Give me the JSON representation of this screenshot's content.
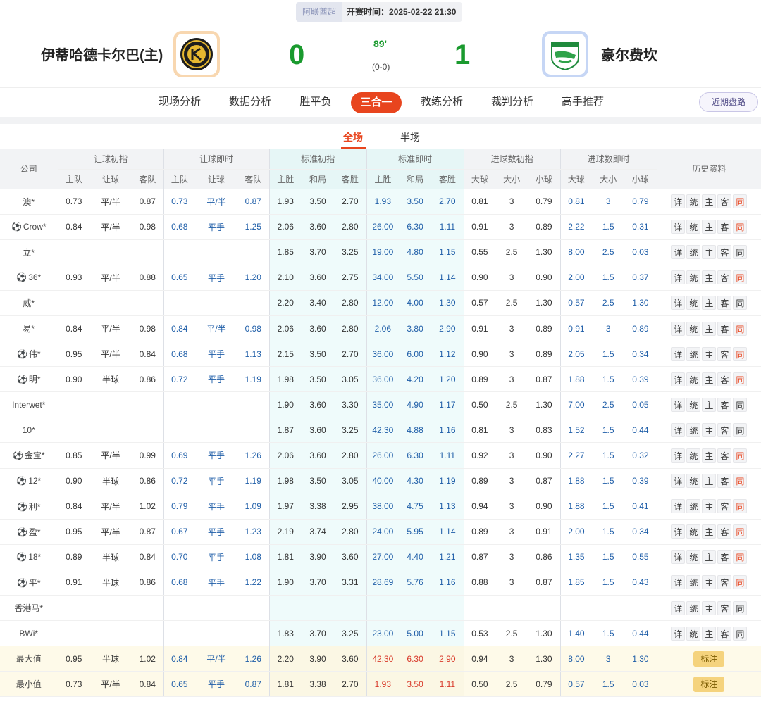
{
  "match": {
    "league": "阿联酋超",
    "kickoff": "开赛时间：2025-02-22 21:30",
    "home": {
      "name": "伊蒂哈德卡尔巴(主)",
      "logo_icon": "etihad-kalba-crest-icon",
      "score": "0"
    },
    "away": {
      "name": "豪尔费坎",
      "logo_icon": "khor-fakkan-crest-icon",
      "score": "1"
    },
    "minute": "89'",
    "halftime": "(0-0)"
  },
  "nav": {
    "tabs": [
      "现场分析",
      "数据分析",
      "胜平负",
      "三合一",
      "教练分析",
      "裁判分析",
      "高手推荐"
    ],
    "active": "三合一",
    "right_button": "近期盘路"
  },
  "subtabs": {
    "full": "全场",
    "half": "半场"
  },
  "table": {
    "groups": {
      "company": "公司",
      "ah_init": "让球初指",
      "ah_live": "让球即时",
      "eu_init": "标准初指",
      "eu_live": "标准即时",
      "ou_init": "进球数初指",
      "ou_live": "进球数即时",
      "history": "历史资料"
    },
    "sub": {
      "home": "主队",
      "handicap": "让球",
      "away": "客队",
      "win": "主胜",
      "draw": "和局",
      "lose": "客胜",
      "over": "大球",
      "line": "大小",
      "under": "小球"
    },
    "history_buttons": [
      "详",
      "统",
      "主",
      "客",
      "同"
    ],
    "rows": [
      {
        "company": "澳*",
        "ball": false,
        "ah_init": [
          "0.73",
          "平/半",
          "0.87"
        ],
        "ah_live": [
          "0.73",
          "平/半",
          "0.87"
        ],
        "eu_init": [
          "1.93",
          "3.50",
          "2.70"
        ],
        "eu_live": [
          "1.93",
          "3.50",
          "2.70"
        ],
        "ou_init": [
          "0.81",
          "3",
          "0.79"
        ],
        "ou_live": [
          "0.81",
          "3",
          "0.79"
        ],
        "same_red": true
      },
      {
        "company": "Crow*",
        "ball": true,
        "ah_init": [
          "0.84",
          "平/半",
          "0.98"
        ],
        "ah_live": [
          "0.68",
          "平手",
          "1.25"
        ],
        "eu_init": [
          "2.06",
          "3.60",
          "2.80"
        ],
        "eu_live": [
          "26.00",
          "6.30",
          "1.11"
        ],
        "ou_init": [
          "0.91",
          "3",
          "0.89"
        ],
        "ou_live": [
          "2.22",
          "1.5",
          "0.31"
        ],
        "same_red": true
      },
      {
        "company": "立*",
        "ball": false,
        "ah_init": [
          "",
          "",
          ""
        ],
        "ah_live": [
          "",
          "",
          ""
        ],
        "eu_init": [
          "1.85",
          "3.70",
          "3.25"
        ],
        "eu_live": [
          "19.00",
          "4.80",
          "1.15"
        ],
        "ou_init": [
          "0.55",
          "2.5",
          "1.30"
        ],
        "ou_live": [
          "8.00",
          "2.5",
          "0.03"
        ],
        "same_red": false
      },
      {
        "company": "36*",
        "ball": true,
        "ah_init": [
          "0.93",
          "平/半",
          "0.88"
        ],
        "ah_live": [
          "0.65",
          "平手",
          "1.20"
        ],
        "eu_init": [
          "2.10",
          "3.60",
          "2.75"
        ],
        "eu_live": [
          "34.00",
          "5.50",
          "1.14"
        ],
        "ou_init": [
          "0.90",
          "3",
          "0.90"
        ],
        "ou_live": [
          "2.00",
          "1.5",
          "0.37"
        ],
        "same_red": true
      },
      {
        "company": "威*",
        "ball": false,
        "ah_init": [
          "",
          "",
          ""
        ],
        "ah_live": [
          "",
          "",
          ""
        ],
        "eu_init": [
          "2.20",
          "3.40",
          "2.80"
        ],
        "eu_live": [
          "12.00",
          "4.00",
          "1.30"
        ],
        "ou_init": [
          "0.57",
          "2.5",
          "1.30"
        ],
        "ou_live": [
          "0.57",
          "2.5",
          "1.30"
        ],
        "same_red": false
      },
      {
        "company": "易*",
        "ball": false,
        "ah_init": [
          "0.84",
          "平/半",
          "0.98"
        ],
        "ah_live": [
          "0.84",
          "平/半",
          "0.98"
        ],
        "eu_init": [
          "2.06",
          "3.60",
          "2.80"
        ],
        "eu_live": [
          "2.06",
          "3.80",
          "2.90"
        ],
        "ou_init": [
          "0.91",
          "3",
          "0.89"
        ],
        "ou_live": [
          "0.91",
          "3",
          "0.89"
        ],
        "same_red": true
      },
      {
        "company": "伟*",
        "ball": true,
        "ah_init": [
          "0.95",
          "平/半",
          "0.84"
        ],
        "ah_live": [
          "0.68",
          "平手",
          "1.13"
        ],
        "eu_init": [
          "2.15",
          "3.50",
          "2.70"
        ],
        "eu_live": [
          "36.00",
          "6.00",
          "1.12"
        ],
        "ou_init": [
          "0.90",
          "3",
          "0.89"
        ],
        "ou_live": [
          "2.05",
          "1.5",
          "0.34"
        ],
        "same_red": true
      },
      {
        "company": "明*",
        "ball": true,
        "ah_init": [
          "0.90",
          "半球",
          "0.86"
        ],
        "ah_live": [
          "0.72",
          "平手",
          "1.19"
        ],
        "eu_init": [
          "1.98",
          "3.50",
          "3.05"
        ],
        "eu_live": [
          "36.00",
          "4.20",
          "1.20"
        ],
        "ou_init": [
          "0.89",
          "3",
          "0.87"
        ],
        "ou_live": [
          "1.88",
          "1.5",
          "0.39"
        ],
        "same_red": true
      },
      {
        "company": "Interwet*",
        "ball": false,
        "ah_init": [
          "",
          "",
          ""
        ],
        "ah_live": [
          "",
          "",
          ""
        ],
        "eu_init": [
          "1.90",
          "3.60",
          "3.30"
        ],
        "eu_live": [
          "35.00",
          "4.90",
          "1.17"
        ],
        "ou_init": [
          "0.50",
          "2.5",
          "1.30"
        ],
        "ou_live": [
          "7.00",
          "2.5",
          "0.05"
        ],
        "same_red": false
      },
      {
        "company": "10*",
        "ball": false,
        "ah_init": [
          "",
          "",
          ""
        ],
        "ah_live": [
          "",
          "",
          ""
        ],
        "eu_init": [
          "1.87",
          "3.60",
          "3.25"
        ],
        "eu_live": [
          "42.30",
          "4.88",
          "1.16"
        ],
        "ou_init": [
          "0.81",
          "3",
          "0.83"
        ],
        "ou_live": [
          "1.52",
          "1.5",
          "0.44"
        ],
        "same_red": false
      },
      {
        "company": "金宝*",
        "ball": true,
        "ah_init": [
          "0.85",
          "平/半",
          "0.99"
        ],
        "ah_live": [
          "0.69",
          "平手",
          "1.26"
        ],
        "eu_init": [
          "2.06",
          "3.60",
          "2.80"
        ],
        "eu_live": [
          "26.00",
          "6.30",
          "1.11"
        ],
        "ou_init": [
          "0.92",
          "3",
          "0.90"
        ],
        "ou_live": [
          "2.27",
          "1.5",
          "0.32"
        ],
        "same_red": true
      },
      {
        "company": "12*",
        "ball": true,
        "ah_init": [
          "0.90",
          "半球",
          "0.86"
        ],
        "ah_live": [
          "0.72",
          "平手",
          "1.19"
        ],
        "eu_init": [
          "1.98",
          "3.50",
          "3.05"
        ],
        "eu_live": [
          "40.00",
          "4.30",
          "1.19"
        ],
        "ou_init": [
          "0.89",
          "3",
          "0.87"
        ],
        "ou_live": [
          "1.88",
          "1.5",
          "0.39"
        ],
        "same_red": true
      },
      {
        "company": "利*",
        "ball": true,
        "ah_init": [
          "0.84",
          "平/半",
          "1.02"
        ],
        "ah_live": [
          "0.79",
          "平手",
          "1.09"
        ],
        "eu_init": [
          "1.97",
          "3.38",
          "2.95"
        ],
        "eu_live": [
          "38.00",
          "4.75",
          "1.13"
        ],
        "ou_init": [
          "0.94",
          "3",
          "0.90"
        ],
        "ou_live": [
          "1.88",
          "1.5",
          "0.41"
        ],
        "same_red": true
      },
      {
        "company": "盈*",
        "ball": true,
        "ah_init": [
          "0.95",
          "平/半",
          "0.87"
        ],
        "ah_live": [
          "0.67",
          "平手",
          "1.23"
        ],
        "eu_init": [
          "2.19",
          "3.74",
          "2.80"
        ],
        "eu_live": [
          "24.00",
          "5.95",
          "1.14"
        ],
        "ou_init": [
          "0.89",
          "3",
          "0.91"
        ],
        "ou_live": [
          "2.00",
          "1.5",
          "0.34"
        ],
        "same_red": true
      },
      {
        "company": "18*",
        "ball": true,
        "ah_init": [
          "0.89",
          "半球",
          "0.84"
        ],
        "ah_live": [
          "0.70",
          "平手",
          "1.08"
        ],
        "eu_init": [
          "1.81",
          "3.90",
          "3.60"
        ],
        "eu_live": [
          "27.00",
          "4.40",
          "1.21"
        ],
        "ou_init": [
          "0.87",
          "3",
          "0.86"
        ],
        "ou_live": [
          "1.35",
          "1.5",
          "0.55"
        ],
        "same_red": true
      },
      {
        "company": "平*",
        "ball": true,
        "ah_init": [
          "0.91",
          "半球",
          "0.86"
        ],
        "ah_live": [
          "0.68",
          "平手",
          "1.22"
        ],
        "eu_init": [
          "1.90",
          "3.70",
          "3.31"
        ],
        "eu_live": [
          "28.69",
          "5.76",
          "1.16"
        ],
        "ou_init": [
          "0.88",
          "3",
          "0.87"
        ],
        "ou_live": [
          "1.85",
          "1.5",
          "0.43"
        ],
        "same_red": true
      },
      {
        "company": "香港马*",
        "ball": false,
        "ah_init": [
          "",
          "",
          ""
        ],
        "ah_live": [
          "",
          "",
          ""
        ],
        "eu_init": [
          "",
          "",
          ""
        ],
        "eu_live": [
          "",
          "",
          ""
        ],
        "ou_init": [
          "",
          "",
          ""
        ],
        "ou_live": [
          "",
          "",
          ""
        ],
        "same_red": false
      },
      {
        "company": "BWi*",
        "ball": false,
        "ah_init": [
          "",
          "",
          ""
        ],
        "ah_live": [
          "",
          "",
          ""
        ],
        "eu_init": [
          "1.83",
          "3.70",
          "3.25"
        ],
        "eu_live": [
          "23.00",
          "5.00",
          "1.15"
        ],
        "ou_init": [
          "0.53",
          "2.5",
          "1.30"
        ],
        "ou_live": [
          "1.40",
          "1.5",
          "0.44"
        ],
        "same_red": false
      }
    ],
    "summary": [
      {
        "label": "最大值",
        "ah_init": [
          "0.95",
          "半球",
          "1.02"
        ],
        "ah_live": [
          "0.84",
          "平/半",
          "1.26"
        ],
        "eu_init": [
          "2.20",
          "3.90",
          "3.60"
        ],
        "eu_live": [
          "42.30",
          "6.30",
          "2.90"
        ],
        "ou_init": [
          "0.94",
          "3",
          "1.30"
        ],
        "ou_live": [
          "8.00",
          "3",
          "1.30"
        ],
        "button": "标注"
      },
      {
        "label": "最小值",
        "ah_init": [
          "0.73",
          "平/半",
          "0.84"
        ],
        "ah_live": [
          "0.65",
          "平手",
          "0.87"
        ],
        "eu_init": [
          "1.81",
          "3.38",
          "2.70"
        ],
        "eu_live": [
          "1.93",
          "3.50",
          "1.11"
        ],
        "ou_init": [
          "0.50",
          "2.5",
          "0.79"
        ],
        "ou_live": [
          "0.57",
          "1.5",
          "0.03"
        ],
        "button": "标注"
      }
    ]
  },
  "colors": {
    "accent": "#e8451e",
    "score": "#1a9a2e",
    "live_value": "#1f5ea8",
    "extreme_value": "#d8392a"
  }
}
